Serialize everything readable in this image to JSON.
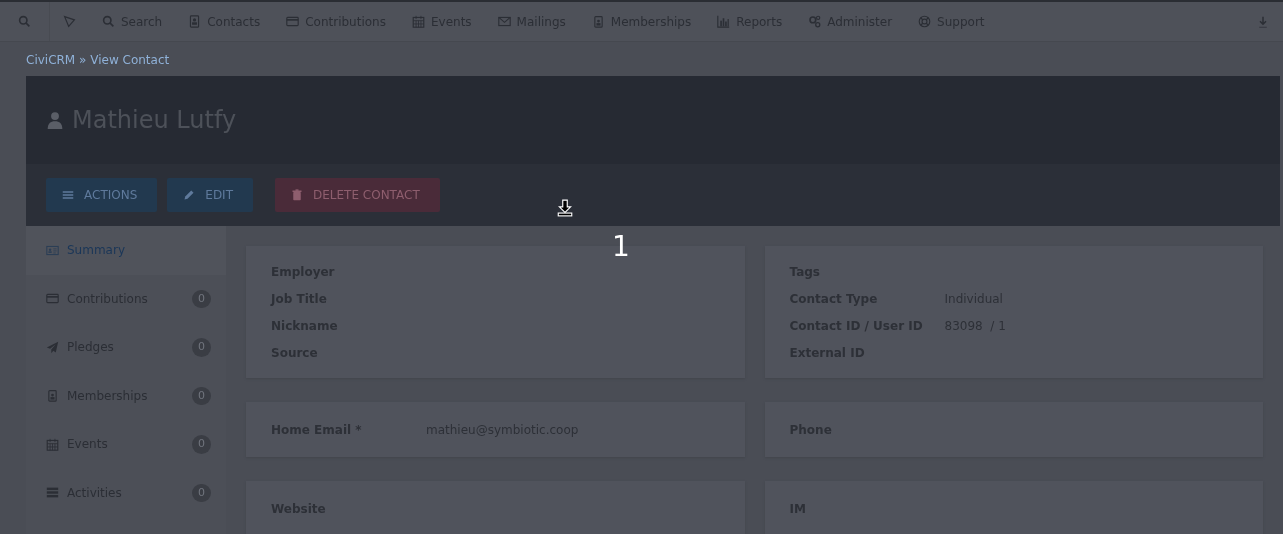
{
  "menu": [
    {
      "kind": "icon"
    },
    {
      "kind": "icon"
    },
    {
      "label": "Search"
    },
    {
      "label": "Contacts"
    },
    {
      "label": "Contributions"
    },
    {
      "label": "Events"
    },
    {
      "label": "Mailings"
    },
    {
      "label": "Memberships"
    },
    {
      "label": "Reports"
    },
    {
      "label": "Administer"
    },
    {
      "label": "Support"
    }
  ],
  "breadcrumb": {
    "links": [
      "CiviCRM",
      "View Contact"
    ],
    "separator": "»"
  },
  "contact": {
    "name": "Mathieu Lutfy"
  },
  "actions": [
    {
      "label": "ACTIONS",
      "kind": "actions"
    },
    {
      "label": "EDIT",
      "kind": "edit"
    },
    {
      "label": "DELETE CONTACT",
      "kind": "delete"
    }
  ],
  "sidebar": {
    "items": [
      {
        "label": "Summary",
        "selected": true
      },
      {
        "label": "Contributions",
        "count": "0",
        "selected": false
      },
      {
        "label": "Pledges",
        "count": "0",
        "selected": false
      },
      {
        "label": "Memberships",
        "count": "0",
        "selected": false
      },
      {
        "label": "Events",
        "count": "0",
        "selected": false
      },
      {
        "label": "Activities",
        "count": "0",
        "selected": false
      }
    ]
  },
  "panels": [
    {
      "left": [
        {
          "label": "Employer"
        },
        {
          "label": "Job Title"
        },
        {
          "label": "Nickname"
        },
        {
          "label": "Source"
        }
      ],
      "right": [
        {
          "label": "Tags"
        },
        {
          "label": "Contact Type",
          "value": "Individual"
        },
        {
          "label": "Contact ID / User ID",
          "value": "83098  / 1"
        },
        {
          "label": "External ID"
        }
      ]
    },
    {
      "left": [
        {
          "label": "Home Email *",
          "value": "mathieu@symbiotic.coop"
        }
      ],
      "right": [
        {
          "label": "Phone"
        }
      ]
    },
    {
      "left": [
        {
          "label": "Website"
        }
      ],
      "right": [
        {
          "label": "IM"
        }
      ]
    }
  ],
  "step_marker": "1"
}
